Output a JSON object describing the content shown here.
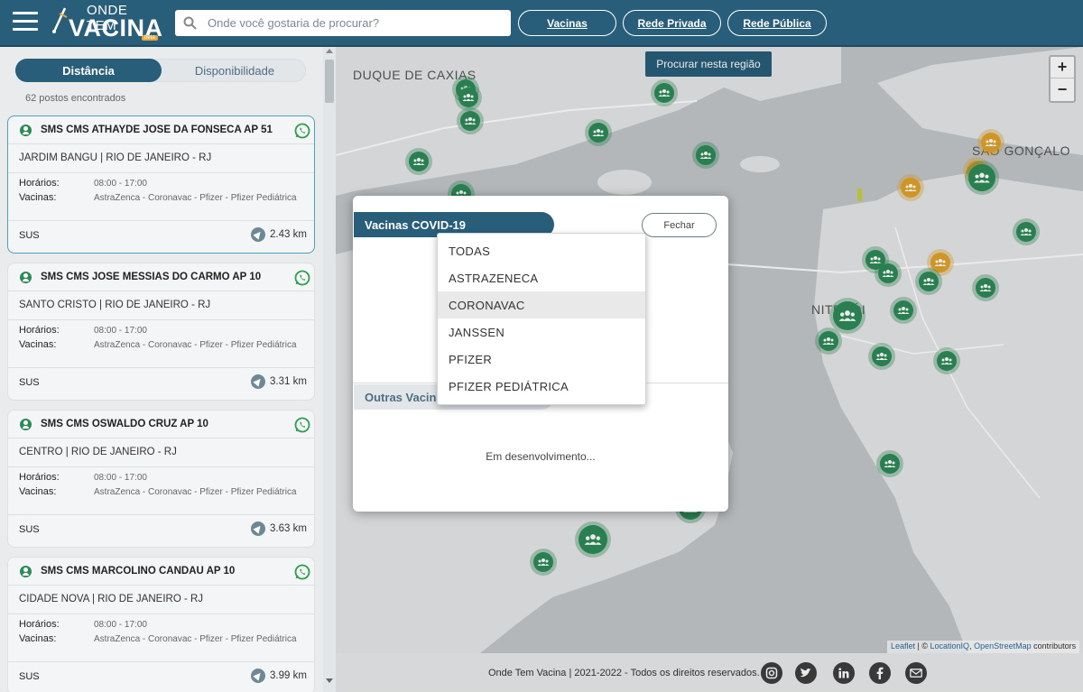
{
  "header": {
    "logo_top": "ONDE TEM",
    "logo_main": "VACINA",
    "logo_badge": "beta",
    "search_placeholder": "Onde você gostaria de procurar?",
    "nav": [
      "Vacinas",
      "Rede Privada",
      "Rede Pública"
    ]
  },
  "sidebar": {
    "tabs": {
      "active": "Distância",
      "inactive": "Disponibilidade"
    },
    "found_text": "62 postos encontrados",
    "hours_label": "Horários:",
    "vaccines_label": "Vacinas:",
    "cards": [
      {
        "name": "SMS CMS ATHAYDE JOSE DA FONSECA AP 51",
        "location": "JARDIM BANGU | RIO DE JANEIRO - RJ",
        "hours": "08:00 - 17:00",
        "vaccines": "AstraZenca - Coronavac - Pfizer - Pfizer Pediátrica",
        "type": "SUS",
        "distance": "2.43 km"
      },
      {
        "name": "SMS CMS JOSE MESSIAS DO CARMO AP 10",
        "location": "SANTO CRISTO | RIO DE JANEIRO - RJ",
        "hours": "08:00 - 17:00",
        "vaccines": "AstraZenca - Coronavac - Pfizer - Pfizer Pediátrica",
        "type": "SUS",
        "distance": "3.31 km"
      },
      {
        "name": "SMS CMS OSWALDO CRUZ AP 10",
        "location": "CENTRO | RIO DE JANEIRO - RJ",
        "hours": "08:00 - 17:00",
        "vaccines": "AstraZenca - Coronavac - Pfizer - Pfizer Pediátrica",
        "type": "SUS",
        "distance": "3.63 km"
      },
      {
        "name": "SMS CMS MARCOLINO CANDAU AP 10",
        "location": "CIDADE NOVA | RIO DE JANEIRO - RJ",
        "hours": "08:00 - 17:00",
        "vaccines": "AstraZenca - Coronavac - Pfizer - Pfizer Pediátrica",
        "type": "SUS",
        "distance": "3.99 km"
      }
    ]
  },
  "map": {
    "labels": [
      "DUQUE DE CAXIAS",
      "SÃO GONÇALO",
      "NITERÓI"
    ],
    "region_button": "Procurar nesta região",
    "zoom_in": "+",
    "zoom_out": "−",
    "attribution": {
      "leaflet": "Leaflet",
      "sep": " | © ",
      "liq": "LocationIQ",
      "comma": ", ",
      "osm": "OpenStreetMap",
      "contrib": " contributors"
    }
  },
  "footer": {
    "text": "Onde Tem Vacina | 2021-2022 - Todos os direitos reservados.",
    "social": [
      "instagram-icon",
      "twitter-icon",
      "linkedin-icon",
      "facebook-icon",
      "email-icon"
    ]
  },
  "modal": {
    "tab1": "Vacinas COVID-19",
    "close": "Fechar",
    "tab2": "Outras Vacinas",
    "dev_text": "Em desenvolvimento...",
    "dropdown": [
      "TODAS",
      "ASTRAZENECA",
      "CORONAVAC",
      "JANSSEN",
      "PFIZER",
      "PFIZER PEDIÁTRICA"
    ],
    "dropdown_highlighted": "CORONAVAC"
  },
  "colors": {
    "primary": "#285e7a",
    "marker_green": "#2e8a57",
    "marker_orange": "#e0a32a"
  }
}
